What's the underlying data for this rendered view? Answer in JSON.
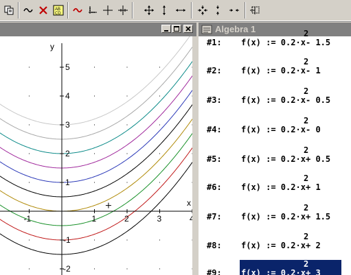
{
  "toolbar": {
    "buttons": [
      {
        "name": "copy-plot-icon"
      },
      {
        "name": "plot-wave-icon"
      },
      {
        "name": "delete-x-icon"
      },
      {
        "name": "rename-ab-icon"
      },
      {
        "name": "plot-expression-icon"
      },
      {
        "name": "axes-icon"
      },
      {
        "name": "crosshair-icon"
      },
      {
        "name": "grid-crosshair-icon"
      },
      {
        "name": "pan-all-icon"
      },
      {
        "name": "pan-vertical-icon"
      },
      {
        "name": "pan-horizontal-icon"
      },
      {
        "name": "zoom-in-all-icon"
      },
      {
        "name": "zoom-in-vertical-icon"
      },
      {
        "name": "zoom-in-horizontal-icon"
      },
      {
        "name": "zoom-box-icon"
      }
    ]
  },
  "plot": {
    "x_axis_label": "x",
    "y_axis_label": "y",
    "x_ticks": [
      "-1",
      "1",
      "2",
      "3",
      "4"
    ],
    "y_ticks": [
      "5",
      "4",
      "3",
      "2",
      "1",
      "-1",
      "-2"
    ],
    "curve_colors": [
      "#c8c8c8",
      "#a8a8a8",
      "#0a8a88",
      "#a0289c",
      "#2a38b8",
      "#000000",
      "#b08a08",
      "#189028",
      "#c01818",
      "#000000"
    ]
  },
  "chart_data": {
    "type": "line",
    "title": "",
    "xlabel": "x",
    "ylabel": "y",
    "xlim": [
      -1.9,
      4
    ],
    "ylim": [
      -2.5,
      5.3
    ],
    "series": [
      {
        "a": 0.2,
        "c": 3
      },
      {
        "a": 0.2,
        "c": 2
      },
      {
        "a": 0.2,
        "c": 1.5
      },
      {
        "a": 0.2,
        "c": 1
      },
      {
        "a": 0.2,
        "c": 0.5
      },
      {
        "a": 0.2,
        "c": 0
      },
      {
        "a": 0.2,
        "c": -0.5
      },
      {
        "a": 0.2,
        "c": -1
      },
      {
        "a": 0.2,
        "c": -1.5
      },
      {
        "a": 0.2,
        "c": 2.5
      }
    ]
  },
  "algebra": {
    "title": "Algebra 1",
    "rows": [
      {
        "label": "#1:",
        "base": "f(x) := 0.2·x",
        "sup": "2",
        "tail": " - 1.5"
      },
      {
        "label": "#2:",
        "base": "f(x) := 0.2·x",
        "sup": "2",
        "tail": " - 1"
      },
      {
        "label": "#3:",
        "base": "f(x) := 0.2·x",
        "sup": "2",
        "tail": " - 0.5"
      },
      {
        "label": "#4:",
        "base": "f(x) := 0.2·x",
        "sup": "2",
        "tail": " - 0"
      },
      {
        "label": "#5:",
        "base": "f(x) := 0.2·x",
        "sup": "2",
        "tail": " + 0.5"
      },
      {
        "label": "#6:",
        "base": "f(x) := 0.2·x",
        "sup": "2",
        "tail": " + 1"
      },
      {
        "label": "#7:",
        "base": "f(x) := 0.2·x",
        "sup": "2",
        "tail": " + 1.5"
      },
      {
        "label": "#8:",
        "base": "f(x) := 0.2·x",
        "sup": "2",
        "tail": " + 2"
      },
      {
        "label": "#9:",
        "base": "f(x) := 0.2·x",
        "sup": "2",
        "tail": " + 3",
        "selected": true
      }
    ]
  }
}
